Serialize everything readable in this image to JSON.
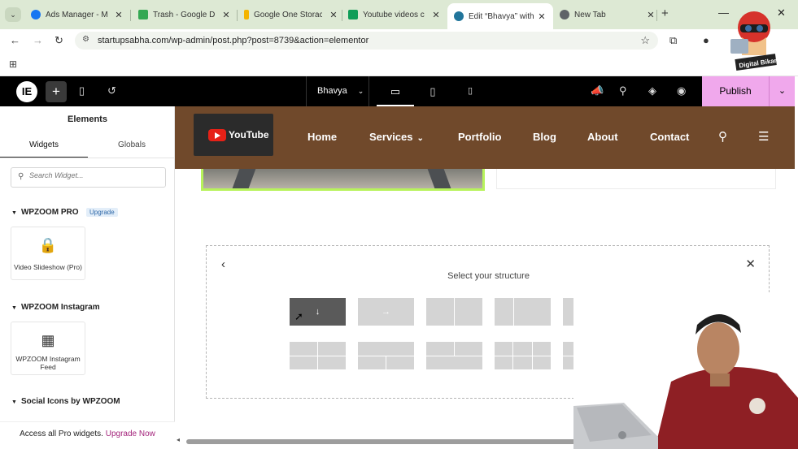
{
  "browser": {
    "tabs": [
      {
        "title": "Ads Manager - Ma",
        "favicon_color": "#1877f2"
      },
      {
        "title": "Trash - Google Dri",
        "favicon_color": "#34a853"
      },
      {
        "title": "Google One Storac",
        "favicon_color": "#f4b400"
      },
      {
        "title": "Youtube videos co",
        "favicon_color": "#0f9d58"
      },
      {
        "title": "Edit “Bhavya” with",
        "favicon_color": "#21759b",
        "active": true
      },
      {
        "title": "New Tab",
        "favicon_color": "#5f6368"
      }
    ],
    "url": "startupsabha.com/wp-admin/post.php?post=8739&action=elementor"
  },
  "channel_logo": {
    "text": "Digital Bikana"
  },
  "elementor_top": {
    "logo_icon": "elementor-logo-icon",
    "page_name": "Bhavya",
    "publish_label": "Publish",
    "accent": "#f0a8ec"
  },
  "panel": {
    "title": "Elements",
    "tabs": [
      "Widgets",
      "Globals"
    ],
    "search_placeholder": "Search Widget...",
    "categories": [
      {
        "name": "WPZOOM PRO",
        "badge": "Upgrade"
      },
      {
        "name": "WPZOOM Instagram"
      },
      {
        "name": "Social Icons by WPZOOM"
      }
    ],
    "widgets": [
      {
        "label": "Video Slideshow (Pro)",
        "icon": "lock-icon"
      },
      {
        "label": "WPZOOM Instagram Feed",
        "icon": "instagram-grid-icon"
      }
    ],
    "footer_text": "Access all Pro widgets.",
    "footer_link": "Upgrade Now"
  },
  "site_header": {
    "logo_text": "YouTube",
    "nav": [
      "Home",
      "Services",
      "Portfolio",
      "Blog",
      "About",
      "Contact"
    ],
    "bg": "#70492b"
  },
  "structure_picker": {
    "title": "Select your structure"
  }
}
